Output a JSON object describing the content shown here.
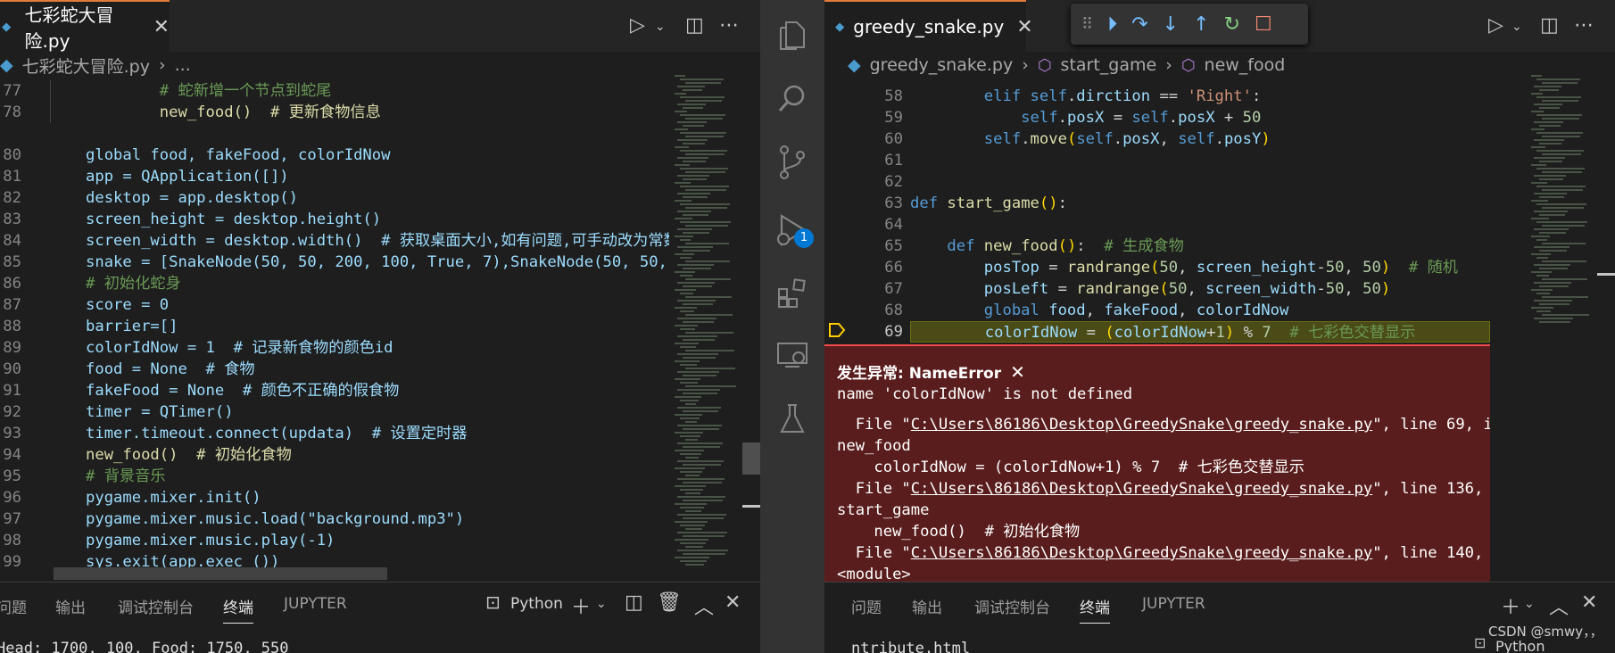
{
  "left_editor": {
    "tab_title": "七彩蛇大冒险.py",
    "breadcrumb": [
      "七彩蛇大冒险.py",
      "..."
    ],
    "line_numbers": [
      "77",
      "78",
      "80",
      "81",
      "82",
      "83",
      "84",
      "85",
      "86",
      "87",
      "88",
      "89",
      "90",
      "91",
      "92",
      "93",
      "94",
      "95",
      "96",
      "97",
      "98",
      "99"
    ],
    "code_lines": [
      "        # 蛇新增一个节点到蛇尾",
      "        new_food()  # 更新食物信息",
      "",
      "global food, fakeFood, colorIdNow",
      "app = QApplication([])",
      "desktop = app.desktop()",
      "screen_height = desktop.height()",
      "screen_width = desktop.width()  # 获取桌面大小,如有问题,可手动改为常数",
      "snake = [SnakeNode(50, 50, 200, 100, True, 7),SnakeNode(50, 50, 15",
      "# 初始化蛇身",
      "score = 0",
      "barrier=[]",
      "colorIdNow = 1  # 记录新食物的颜色id",
      "food = None  # 食物",
      "fakeFood = None  # 颜色不正确的假食物",
      "timer = QTimer()",
      "timer.timeout.connect(updata)  # 设置定时器",
      "new_food()  # 初始化食物",
      "# 背景音乐",
      "pygame.mixer.init()",
      "pygame.mixer.music.load(\"background.mp3\")",
      "pygame.mixer.music.play(-1)",
      "sys.exit(app.exec_())"
    ],
    "panel_tabs": [
      "问题",
      "输出",
      "调试控制台",
      "终端",
      "JUPYTER"
    ],
    "active_panel_tab": "终端",
    "terminal_profile": "Python",
    "terminal_output": "Head: 1700, 100, Food: 1750, 550"
  },
  "activity_bar": {
    "items": [
      "files-icon",
      "search-icon",
      "source-control-icon",
      "run-debug-icon",
      "extensions-icon",
      "remote-explorer-icon",
      "testing-icon"
    ],
    "debug_badge": "1"
  },
  "right_editor": {
    "tab_title": "greedy_snake.py",
    "breadcrumb": [
      "greedy_snake.py",
      "start_game",
      "new_food"
    ],
    "line_numbers": [
      "58",
      "59",
      "60",
      "61",
      "62",
      "63",
      "64",
      "65",
      "66",
      "67",
      "68",
      "69"
    ],
    "current_line": "69",
    "exception": {
      "title": "发生异常: NameError",
      "message": "name 'colorIdNow' is not defined",
      "traceback": [
        {
          "prefix": "  File \"",
          "path": "C:\\Users\\86186\\Desktop\\GreedySnake\\greedy_snake.py",
          "suffix": "\", line 69, in"
        },
        {
          "text": "new_food"
        },
        {
          "text": "    colorIdNow = (colorIdNow+1) % 7  # 七彩色交替显示"
        },
        {
          "prefix": "  File \"",
          "path": "C:\\Users\\86186\\Desktop\\GreedySnake\\greedy_snake.py",
          "suffix": "\", line 136, in"
        },
        {
          "text": "start_game"
        },
        {
          "text": "    new_food()  # 初始化食物"
        },
        {
          "prefix": "  File \"",
          "path": "C:\\Users\\86186\\Desktop\\GreedySnake\\greedy_snake.py",
          "suffix": "\", line 140, in"
        },
        {
          "text": "<module>"
        }
      ]
    },
    "panel_tabs": [
      "问题",
      "输出",
      "调试控制台",
      "终端",
      "JUPYTER"
    ],
    "active_panel_tab": "终端",
    "terminal_output": "ntribute.html",
    "terminal_profile": "Python",
    "watermark": "CSDN @smwy，，"
  }
}
